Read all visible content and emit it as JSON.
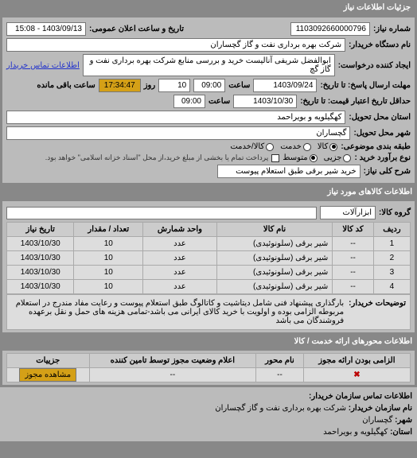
{
  "header": {
    "title": "جزئیات اطلاعات نیاز"
  },
  "top": {
    "req_no_label": "شماره نیاز:",
    "req_no": "1103092660000796",
    "ann_date_label": "تاریخ و ساعت اعلان عمومی:",
    "ann_date": "1403/09/13 - 15:08",
    "buyer_label": "نام دستگاه خریدار:",
    "buyer": "شرکت بهره برداری نفت و گاز گچساران",
    "creator_label": "ایجاد کننده درخواست:",
    "creator": "ابوالفضل شریفی آنالیست خرید و بررسی منابع شرکت بهره برداری نفت و گاز گچ",
    "contact_link": "اطلاعات تماس خریدار",
    "deadline_label": "مهلت ارسال پاسخ: تا تاریخ:",
    "deadline_date": "1403/09/24",
    "time_label": "ساعت",
    "deadline_time": "09:00",
    "days_left": "10",
    "days_left_label": "روز",
    "timer": "17:34:47",
    "timer_label": "ساعت باقی مانده",
    "validity_label": "حداقل تاریخ اعتبار قیمت: تا تاریخ:",
    "validity_date": "1403/10/30",
    "validity_time": "09:00",
    "province_label": "استان محل تحویل:",
    "province": "کهگیلویه و بویراحمد",
    "city_label": "شهر محل تحویل:",
    "city": "گچساران",
    "budget_label": "طبقه بندی موضوعی:",
    "budget_opts": {
      "opt1": "کالا",
      "opt2": "خدمت",
      "opt3": "کالا/خدمت"
    },
    "purchase_type_label": "نوع برآورد خرید :",
    "purchase_opts": {
      "opt1": "جزیی",
      "opt2": "متوسط"
    },
    "purchase_note": "پرداخت تمام یا بخشی از مبلغ خرید،از محل \"اسناد خزانه اسلامی\" خواهد بود.",
    "subject_label": "شرح کلی نیاز:",
    "subject": "خرید شیر برقی طبق استعلام پیوست"
  },
  "goods": {
    "title": "اطلاعات کالاهای مورد نیاز",
    "group_label": "گروه کالا:",
    "group": "ابزارآلات",
    "cols": {
      "row": "ردیف",
      "code": "کد کالا",
      "name": "نام کالا",
      "unit": "واحد شمارش",
      "qty": "تعداد / مقدار",
      "date": "تاریخ نیاز"
    },
    "rows": [
      {
        "r": "1",
        "code": "--",
        "name": "شیر برقی (سلونوئیدی)",
        "unit": "عدد",
        "qty": "10",
        "date": "1403/10/30"
      },
      {
        "r": "2",
        "code": "--",
        "name": "شیر برقی (سلونوئیدی)",
        "unit": "عدد",
        "qty": "10",
        "date": "1403/10/30"
      },
      {
        "r": "3",
        "code": "--",
        "name": "شیر برقی (سلونوئیدی)",
        "unit": "عدد",
        "qty": "10",
        "date": "1403/10/30"
      },
      {
        "r": "4",
        "code": "--",
        "name": "شیر برقی (سلونوئیدی)",
        "unit": "عدد",
        "qty": "10",
        "date": "1403/10/30"
      }
    ],
    "desc_label": "توضیحات خریدار:",
    "desc": "بارگذاری پیشنهاد فنی شامل دیتاشیت و کاتالوگ طبق استعلام پیوست و رعایت مفاد مندرج در استعلام مربوطه الزامی بوده و اولویت با خرید کالای ایرانی می باشد-تمامی هزینه های حمل و نقل برعهده فروشندگان می باشد"
  },
  "axes": {
    "title": "اطلاعات محورهای ارائه خدمت / کالا",
    "cols": {
      "required": "الزامی بودن ارائه مجوز",
      "axis": "نام محور",
      "status": "اعلام وضعیت مجوز توسط تامین کننده",
      "details": "جزییات"
    },
    "row1": {
      "required_icon": "✖",
      "axis": "--",
      "status": "--",
      "btn": "مشاهده مجوز"
    }
  },
  "footer": {
    "title": "اطلاعات تماس سازمان خریدار:",
    "org_label": "نام سازمان خریدار:",
    "org": "شرکت بهره برداری نفت و گاز گچساران",
    "city_label": "شهر:",
    "city": "گچساران",
    "province_label": "استان:",
    "province": "کهگیلویه و بویراحمد"
  }
}
